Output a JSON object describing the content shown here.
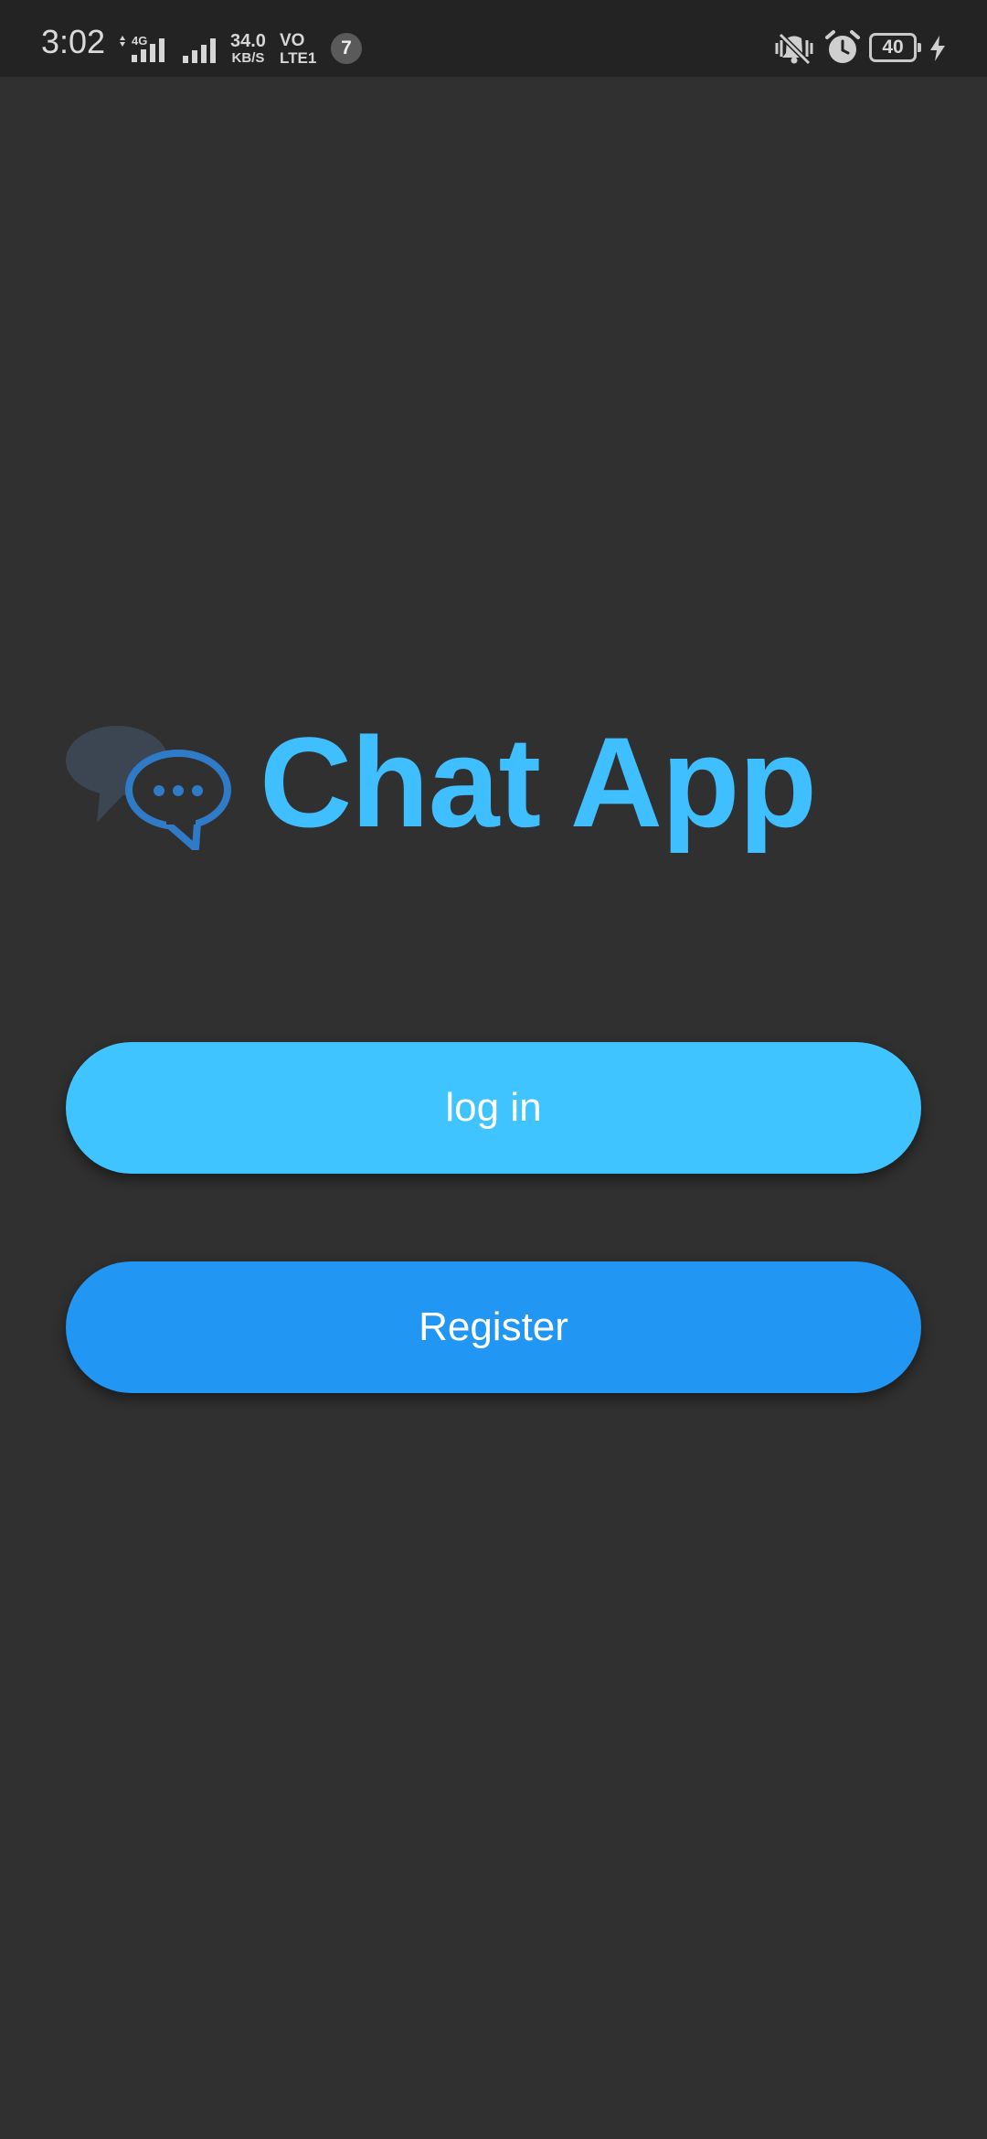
{
  "status_bar": {
    "time": "3:02",
    "network_label": "4G",
    "speed_value": "34.0",
    "speed_unit": "KB/S",
    "volte_top": "VO",
    "volte_bottom": "LTE1",
    "notification_count": "7",
    "battery_level": "40"
  },
  "logo": {
    "icon": "chat-bubbles-icon",
    "title": "Chat App"
  },
  "buttons": {
    "login_label": "log in",
    "register_label": "Register"
  },
  "colors": {
    "background": "#303030",
    "status_bar": "#232323",
    "accent_light_blue": "#40c4ff",
    "accent_blue": "#2196f3",
    "title": "#3fbfff"
  }
}
